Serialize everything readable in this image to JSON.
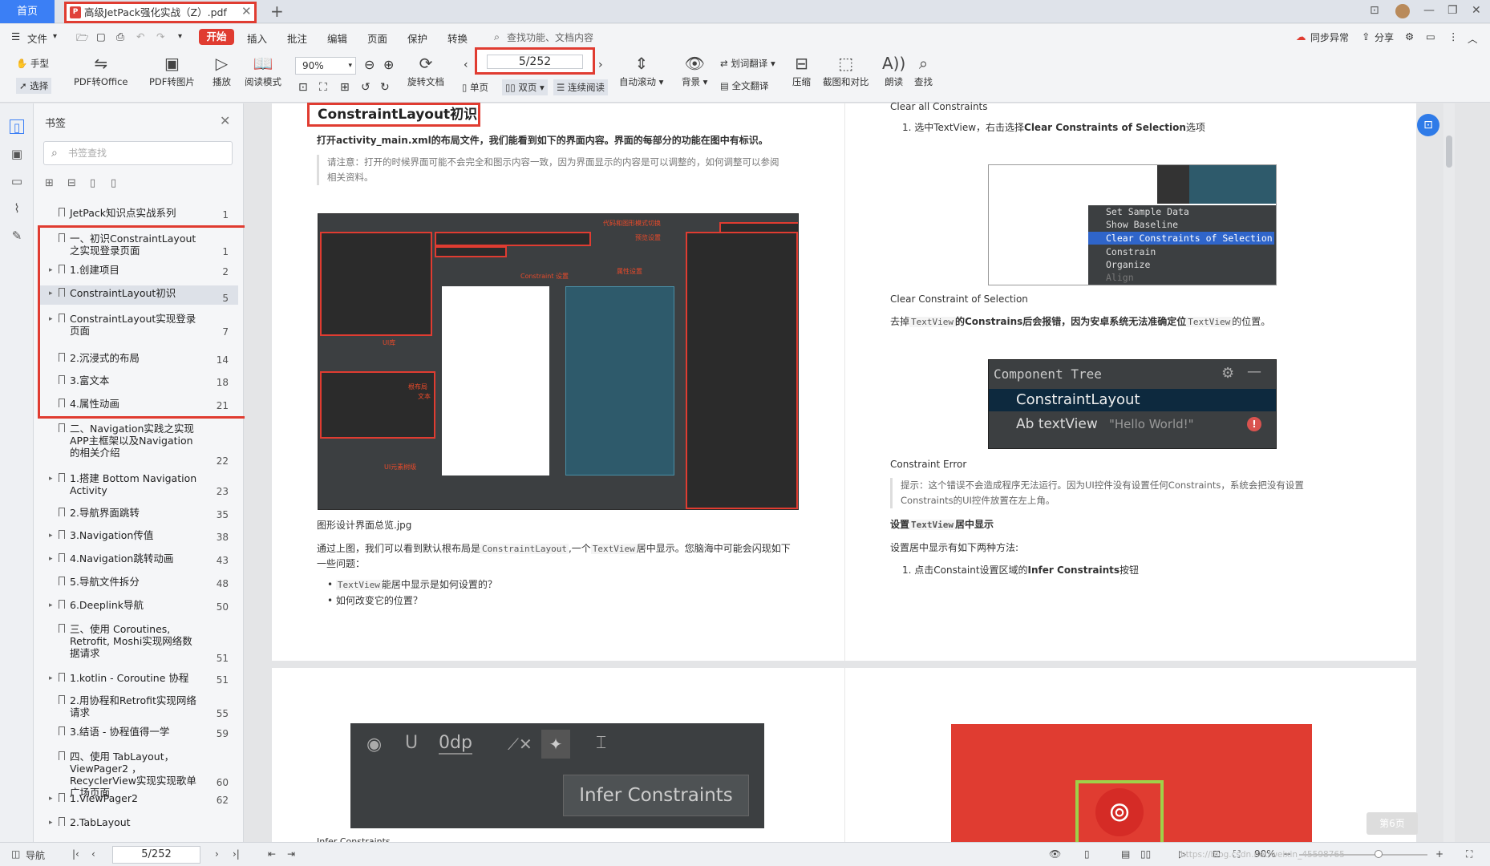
{
  "tabs": {
    "home": "首页",
    "doc_title": "高级JetPack强化实战（Z）.pdf",
    "pdf_badge": "P"
  },
  "menubar": {
    "file": "文件",
    "items": [
      "开始",
      "插入",
      "批注",
      "编辑",
      "页面",
      "保护",
      "转换"
    ],
    "search_placeholder": "查找功能、文档内容",
    "sync": "同步异常",
    "share": "分享"
  },
  "toolbar": {
    "hand": "手型",
    "select": "选择",
    "pdf_to_office": "PDF转Office",
    "pdf_to_image": "PDF转图片",
    "play": "播放",
    "read_mode": "阅读模式",
    "zoom": "90%",
    "page_indicator": "5/252",
    "rotate": "旋转文档",
    "single": "单页",
    "double": "双页",
    "continuous": "连续阅读",
    "autoscroll": "自动滚动",
    "background": "背景",
    "translate": "划词翻译",
    "fulltext_translate": "全文翻译",
    "compress": "压缩",
    "screenshot_compare": "截图和对比",
    "read_aloud": "朗读",
    "find": "查找"
  },
  "sidebar": {
    "title": "书签",
    "search_placeholder": "书签查找",
    "items": [
      {
        "label": "JetPack知识点实战系列",
        "page": "1",
        "arrow": false
      },
      {
        "label": "一、初识ConstraintLayout之实现登录页面",
        "page": "1",
        "arrow": false
      },
      {
        "label": "1.创建项目",
        "page": "2",
        "arrow": true
      },
      {
        "label": "ConstraintLayout初识",
        "page": "5",
        "arrow": true
      },
      {
        "label": "ConstraintLayout实现登录页面",
        "page": "7",
        "arrow": true
      },
      {
        "label": "2.沉浸式的布局",
        "page": "14",
        "arrow": false
      },
      {
        "label": "3.富文本",
        "page": "18",
        "arrow": false
      },
      {
        "label": "4.属性动画",
        "page": "21",
        "arrow": false
      },
      {
        "label": "二、Navigation实践之实现APP主框架以及Navigation的相关介绍",
        "page": "22",
        "arrow": false
      },
      {
        "label": "1.搭建 Bottom Navigation Activity",
        "page": "23",
        "arrow": true
      },
      {
        "label": "2.导航界面跳转",
        "page": "35",
        "arrow": false
      },
      {
        "label": "3.Navigation传值",
        "page": "38",
        "arrow": true
      },
      {
        "label": "4.Navigation跳转动画",
        "page": "43",
        "arrow": true
      },
      {
        "label": "5.导航文件拆分",
        "page": "48",
        "arrow": false
      },
      {
        "label": "6.Deeplink导航",
        "page": "50",
        "arrow": true
      },
      {
        "label": "三、使用 Coroutines, Retrofit, Moshi实现网络数据请求",
        "page": "51",
        "arrow": false
      },
      {
        "label": "1.kotlin - Coroutine 协程",
        "page": "51",
        "arrow": true
      },
      {
        "label": "2.用协程和Retrofit实现网络请求",
        "page": "55",
        "arrow": false
      },
      {
        "label": "3.结语 - 协程值得一学",
        "page": "59",
        "arrow": false
      },
      {
        "label": "四、使用 TabLayout，ViewPager2 ，RecyclerView实现实现歌单广场页面",
        "page": "60",
        "arrow": false
      },
      {
        "label": "1.ViewPager2",
        "page": "62",
        "arrow": true
      },
      {
        "label": "2.TabLayout",
        "page": "",
        "arrow": true
      }
    ]
  },
  "left_page": {
    "heading": "ConstraintLayout初识",
    "intro": "打开activity_main.xml的布局文件，我们能看到如下的界面内容。界面的每部分的功能在图中有标识。",
    "note": "请注意：打开的时候界面可能不会完全和图示内容一致，因为界面显示的内容是可以调整的，如何调整可以参阅相关资料。",
    "caption": "图形设计界面总览.jpg",
    "para_prefix": "通过上图，我们可以看到默认根布局是",
    "code_root": "ConstraintLayout",
    "para_mid": ",一个",
    "code_tv": "TextView",
    "para_suffix": "居中显示。您脑海中可能会闪现如下一些问题：",
    "bullet1_suffix": "能居中显示是如何设置的？",
    "bullet2": "如何改变它的位置？",
    "ide_labels": {
      "mode": "代码和图形模式切换",
      "preview": "预览设置",
      "constraint": "Constraint 设置",
      "attr": "属性设置",
      "ui_lib": "UI库",
      "root": "根布局",
      "text": "文本",
      "ui_tree": "UI元素树级"
    },
    "infer": "Infer Constraints",
    "odp": "0dp",
    "infer_caption": "Infer Constraints"
  },
  "right_page": {
    "clear_all": "Clear all Constraints",
    "step1_prefix": "1. 选中TextView，右击选择",
    "step1_bold": "Clear Constraints of Selection",
    "step1_suffix": "选项",
    "context_menu": [
      "Set Sample Data",
      "Show Baseline",
      "Clear Constraints of Selection",
      "Constrain",
      "Organize",
      "Align"
    ],
    "clear_sel": "Clear Constraint of Selection",
    "remove_prefix": "去掉",
    "remove_code": "TextView",
    "remove_mid": "的Constrains后会报错，因为安卓系统无法准确定位",
    "remove_code2": "TextView",
    "remove_suffix": "的位置。",
    "component_tree": "Component Tree",
    "ct_root": "ConstraintLayout",
    "ct_child": "Ab textView",
    "ct_child_text": "\"Hello World!\"",
    "constraint_error": "Constraint Error",
    "tip": "提示：这个错误不会造成程序无法运行。因为UI控件没有设置任何Constraints，系统会把没有设置Constraints的UI控件放置在左上角。",
    "center_heading_prefix": "设置",
    "center_heading_code": "TextView",
    "center_heading_suffix": "居中显示",
    "center_methods": "设置居中显示有如下两种方法:",
    "method1_prefix": "1. 点击Constaint设置区域的",
    "method1_bold": "Infer Constraints",
    "method1_suffix": "按钮"
  },
  "statusbar": {
    "nav": "导航",
    "page": "5/252",
    "zoom": "90%",
    "next_btn": "第6页",
    "watermark": "https://blog.csdn.net/weixin_45598765"
  },
  "colors": {
    "accent": "#3b7ff5",
    "highlight_red": "#e03c31",
    "start_red": "#e03c31"
  }
}
